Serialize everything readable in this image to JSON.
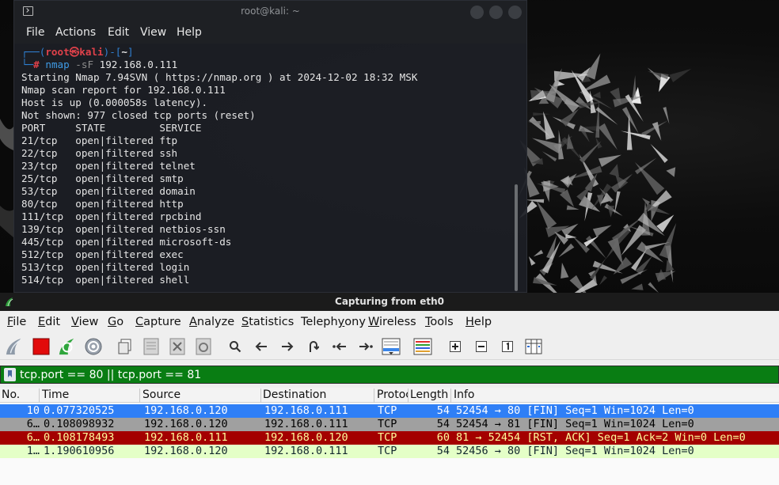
{
  "terminal": {
    "title": "root@kali: ~",
    "menu": [
      "File",
      "Actions",
      "Edit",
      "View",
      "Help"
    ],
    "prompt": {
      "top_prefix": "┌──(",
      "user": "root㉿kali",
      "mid": ")-[",
      "dir": "~",
      "close": "]",
      "bottom_prefix": "└─",
      "hash": "#",
      "cmd": "nmap",
      "flag": "-sF",
      "target": "192.168.0.111"
    },
    "output_lines": [
      "Starting Nmap 7.94SVN ( https://nmap.org ) at 2024-12-02 18:32 MSK",
      "Nmap scan report for 192.168.0.111",
      "Host is up (0.000058s latency).",
      "Not shown: 977 closed tcp ports (reset)",
      "PORT     STATE         SERVICE",
      "21/tcp   open|filtered ftp",
      "22/tcp   open|filtered ssh",
      "23/tcp   open|filtered telnet",
      "25/tcp   open|filtered smtp",
      "53/tcp   open|filtered domain",
      "80/tcp   open|filtered http",
      "111/tcp  open|filtered rpcbind",
      "139/tcp  open|filtered netbios-ssn",
      "445/tcp  open|filtered microsoft-ds",
      "512/tcp  open|filtered exec",
      "513/tcp  open|filtered login",
      "514/tcp  open|filtered shell"
    ]
  },
  "wireshark": {
    "title": "Capturing from eth0",
    "menu": [
      {
        "label": "File",
        "u": "F",
        "rest": "ile"
      },
      {
        "label": "Edit",
        "u": "E",
        "rest": "dit"
      },
      {
        "label": "View",
        "u": "V",
        "rest": "iew"
      },
      {
        "label": "Go",
        "u": "G",
        "rest": "o"
      },
      {
        "label": "Capture",
        "u": "C",
        "rest": "apture"
      },
      {
        "label": "Analyze",
        "u": "A",
        "rest": "nalyze"
      },
      {
        "label": "Statistics",
        "u": "S",
        "rest": "tatistics"
      },
      {
        "label": "Telephony",
        "u": "y",
        "pre": "Teleph",
        "rest2": "ony"
      },
      {
        "label": "Wireless",
        "u": "W",
        "rest": "ireless"
      },
      {
        "label": "Tools",
        "u": "T",
        "rest": "ools"
      },
      {
        "label": "Help",
        "u": "H",
        "rest": "elp"
      }
    ],
    "filter": "tcp.port == 80 || tcp.port == 81",
    "columns": [
      "No.",
      "Time",
      "Source",
      "Destination",
      "Protoc",
      "Length",
      "Info"
    ],
    "packets": [
      {
        "no": "10",
        "time": "0.077320525",
        "source": "192.168.0.120",
        "destination": "192.168.0.111",
        "protocol": "TCP",
        "length": "54",
        "info": "52454 → 80 [FIN] Seq=1 Win=1024 Len=0",
        "bg": "#2f7ff6",
        "fg": "#ffffff"
      },
      {
        "no": "6…",
        "time": "0.108098932",
        "source": "192.168.0.120",
        "destination": "192.168.0.111",
        "protocol": "TCP",
        "length": "54",
        "info": "52454 → 81 [FIN] Seq=1 Win=1024 Len=0",
        "bg": "#a0a0a0",
        "fg": "#000000"
      },
      {
        "no": "6…",
        "time": "0.108178493",
        "source": "192.168.0.111",
        "destination": "192.168.0.120",
        "protocol": "TCP",
        "length": "60",
        "info": "81 → 52454 [RST, ACK] Seq=1 Ack=2 Win=0 Len=0",
        "bg": "#a40000",
        "fg": "#fffc9c"
      },
      {
        "no": "1…",
        "time": "1.190610956",
        "source": "192.168.0.120",
        "destination": "192.168.0.111",
        "protocol": "TCP",
        "length": "54",
        "info": "52456 → 80 [FIN] Seq=1 Win=1024 Len=0",
        "bg": "#e4ffc7",
        "fg": "#12272e"
      }
    ]
  }
}
